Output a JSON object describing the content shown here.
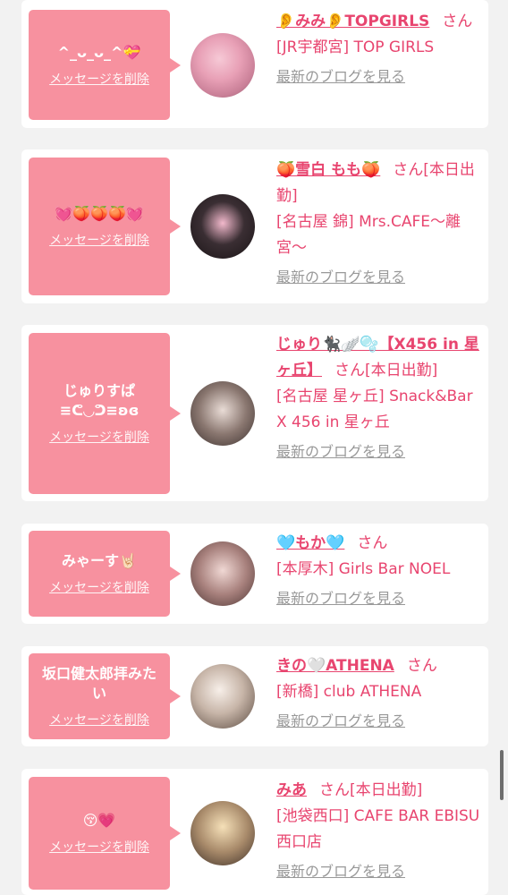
{
  "delete_label": "メッセージを削除",
  "blog_label": "最新のブログを見る",
  "honorific": "さん",
  "entries": [
    {
      "message": "^_ᴗ_ᴗ_^💝",
      "name": "👂みみ👂TOPGIRLS",
      "status": "",
      "shop": "[JR宇都宮] TOP GIRLS"
    },
    {
      "message": "💓🍑🍑🍑💓",
      "name": "🍑雪白 もも🍑",
      "status": "[本日出勤]",
      "shop": "[名古屋 錦] Mrs.CAFE〜離宮〜"
    },
    {
      "message": "じゅりすぱ ≡ᕦ◡ᕤ≡ʚɞ",
      "name": "じゅり🐈‍⬛🪽🫧【X456 in 星ヶ丘】",
      "status": "[本日出勤]",
      "shop": "[名古屋 星ヶ丘] Snack&Bar X 456 in 星ヶ丘"
    },
    {
      "message": "みゃーす🤘🏻",
      "name": "🩵もか🩵",
      "status": "",
      "shop": "[本厚木] Girls Bar NOEL"
    },
    {
      "message": "坂口健太郎拝みたい",
      "name": "きの🤍ATHENA",
      "status": "",
      "shop": "[新橋] club ATHENA"
    },
    {
      "message": "😚💗",
      "name": "みあ",
      "status": "[本日出勤]",
      "shop": "[池袋西口] CAFE BAR EBISU 西口店"
    }
  ],
  "colors": {
    "page_background": "#f2f2f2",
    "card": "#ffffff",
    "bubble": "#f7919f",
    "accent": "#e8456f",
    "muted": "#999999"
  }
}
